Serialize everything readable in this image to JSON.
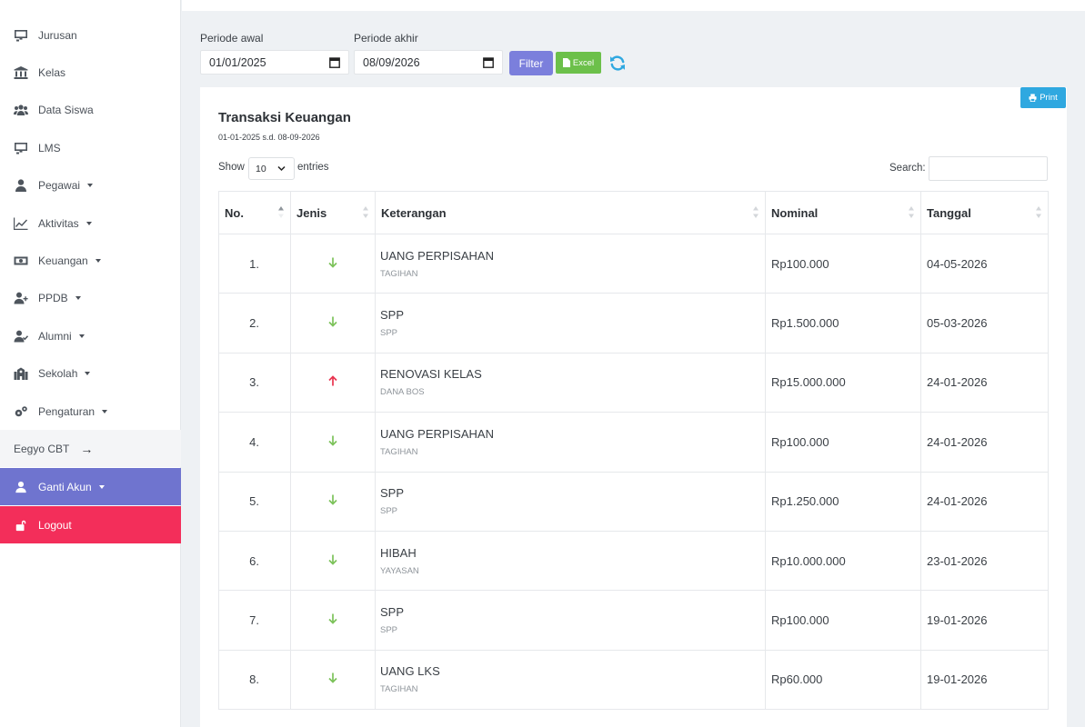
{
  "sidebar": {
    "items": [
      {
        "label": "Jurusan",
        "icon": "chalkboard-icon",
        "caret": false
      },
      {
        "label": "Kelas",
        "icon": "building-columns-icon",
        "caret": false
      },
      {
        "label": "Data Siswa",
        "icon": "users-icon",
        "caret": false
      },
      {
        "label": "LMS",
        "icon": "chalkboard-icon",
        "caret": false
      },
      {
        "label": "Pegawai",
        "icon": "user-icon",
        "caret": true
      },
      {
        "label": "Aktivitas",
        "icon": "chart-line-icon",
        "caret": true
      },
      {
        "label": "Keuangan",
        "icon": "money-bill-icon",
        "caret": true
      },
      {
        "label": "PPDB",
        "icon": "user-plus-icon",
        "caret": true
      },
      {
        "label": "Alumni",
        "icon": "user-check-icon",
        "caret": true
      },
      {
        "label": "Sekolah",
        "icon": "school-icon",
        "caret": true
      },
      {
        "label": "Pengaturan",
        "icon": "cogs-icon",
        "caret": true
      }
    ],
    "cbt_label": "Eegyo CBT",
    "ganti_label": "Ganti Akun",
    "logout_label": "Logout"
  },
  "filter": {
    "start_label": "Periode awal",
    "start_value": "01/01/2025",
    "end_label": "Periode akhir",
    "end_value": "08/09/2026",
    "filter_button": "Filter",
    "excel_button": "Excel"
  },
  "card": {
    "print_button": "Print",
    "title": "Transaksi Keuangan",
    "subtitle": "01-01-2025 s.d. 08-09-2026",
    "show_label": "Show",
    "entries_value": "10",
    "entries_label": "entries",
    "search_label": "Search:"
  },
  "table": {
    "headers": [
      "No.",
      "Jenis",
      "Keterangan",
      "Nominal",
      "Tanggal"
    ],
    "rows": [
      {
        "no": "1.",
        "direction": "in",
        "title": "UANG PERPISAHAN",
        "category": "TAGIHAN",
        "nominal": "Rp100.000",
        "tanggal": "04-05-2026"
      },
      {
        "no": "2.",
        "direction": "in",
        "title": "SPP",
        "category": "SPP",
        "nominal": "Rp1.500.000",
        "tanggal": "05-03-2026"
      },
      {
        "no": "3.",
        "direction": "out",
        "title": "RENOVASI KELAS",
        "category": "DANA BOS",
        "nominal": "Rp15.000.000",
        "tanggal": "24-01-2026"
      },
      {
        "no": "4.",
        "direction": "in",
        "title": "UANG PERPISAHAN",
        "category": "TAGIHAN",
        "nominal": "Rp100.000",
        "tanggal": "24-01-2026"
      },
      {
        "no": "5.",
        "direction": "in",
        "title": "SPP",
        "category": "SPP",
        "nominal": "Rp1.250.000",
        "tanggal": "24-01-2026"
      },
      {
        "no": "6.",
        "direction": "in",
        "title": "HIBAH",
        "category": "YAYASAN",
        "nominal": "Rp10.000.000",
        "tanggal": "23-01-2026"
      },
      {
        "no": "7.",
        "direction": "in",
        "title": "SPP",
        "category": "SPP",
        "nominal": "Rp100.000",
        "tanggal": "19-01-2026"
      },
      {
        "no": "8.",
        "direction": "in",
        "title": "UANG LKS",
        "category": "TAGIHAN",
        "nominal": "Rp60.000",
        "tanggal": "19-01-2026"
      }
    ]
  },
  "colors": {
    "in_arrow": "#7cc25a",
    "out_arrow": "#e8344f",
    "ganti_bg": "#6f74cf",
    "logout_bg": "#f32e5a"
  }
}
